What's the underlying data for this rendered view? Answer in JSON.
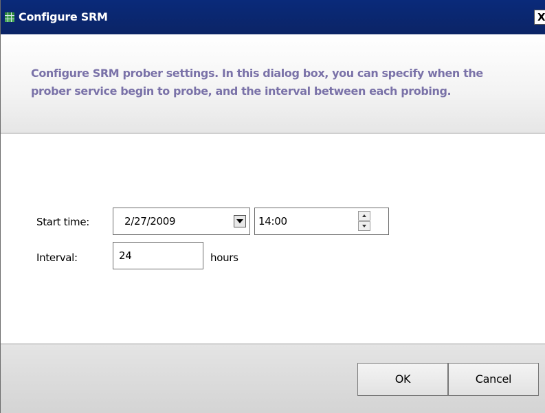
{
  "window": {
    "title": "Configure SRM",
    "close_label": "X",
    "icon": "app-grid-icon"
  },
  "header": {
    "description": "Configure SRM prober settings. In this dialog box, you can specify when the prober service begin to probe, and the interval between each probing."
  },
  "form": {
    "start_time_label": "Start time:",
    "start_date_value": "2/27/2009",
    "start_time_value": "14:00",
    "interval_label": "Interval:",
    "interval_value": "24",
    "interval_unit": "hours"
  },
  "footer": {
    "ok_label": "OK",
    "cancel_label": "Cancel"
  },
  "colors": {
    "titlebar": "#0a2a7a",
    "description_text": "#7a72a8"
  }
}
